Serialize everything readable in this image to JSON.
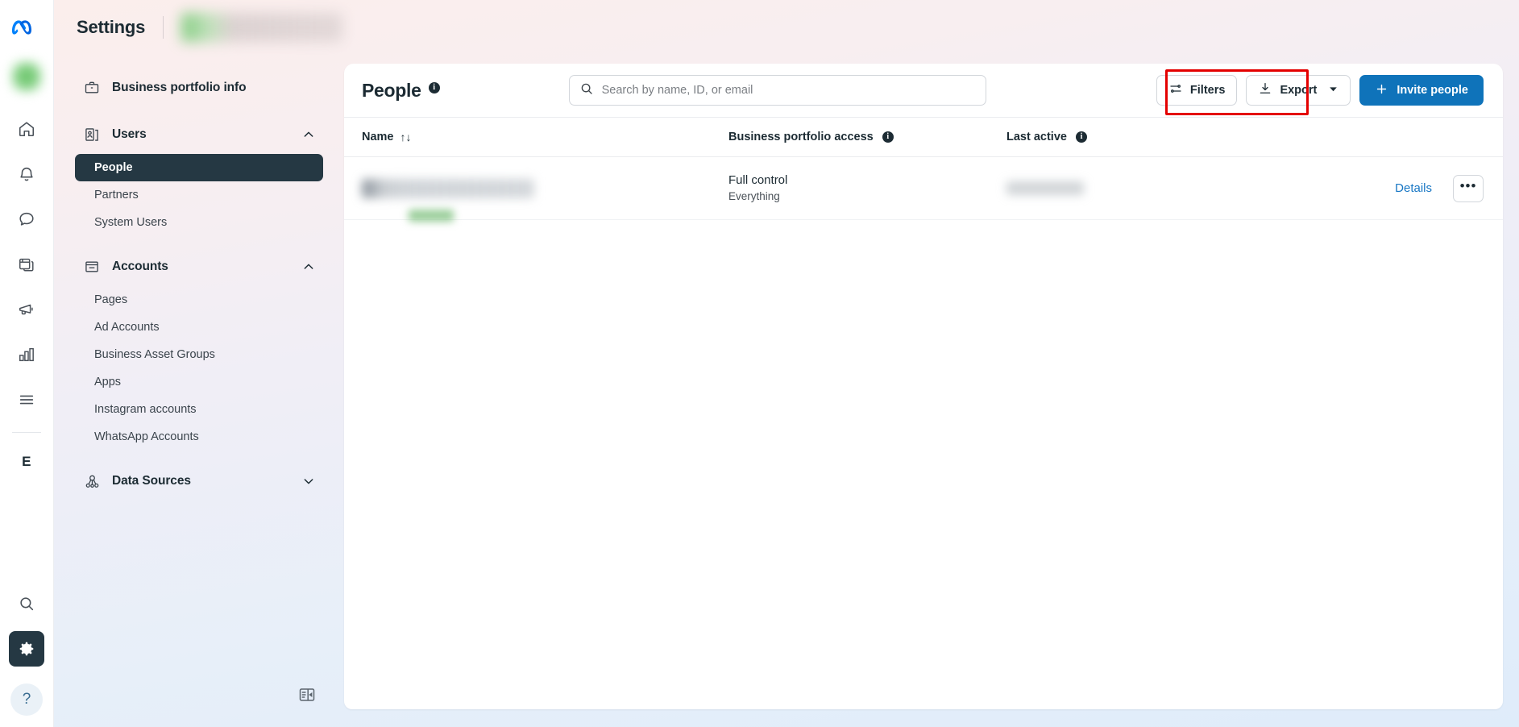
{
  "rail": {
    "logo": "meta-logo",
    "avatar": "user-avatar-blurred",
    "items": [
      {
        "icon": "home-icon",
        "name": "home"
      },
      {
        "icon": "bell-icon",
        "name": "notifications"
      },
      {
        "icon": "chat-bubble-icon",
        "name": "messages"
      },
      {
        "icon": "pages-icon",
        "name": "pages"
      },
      {
        "icon": "megaphone-icon",
        "name": "ads"
      },
      {
        "icon": "bar-chart-icon",
        "name": "insights"
      },
      {
        "icon": "menu-icon",
        "name": "all-tools"
      }
    ],
    "letter_badge": "E",
    "bottom": [
      {
        "icon": "search-icon",
        "name": "search",
        "active": false
      },
      {
        "icon": "gear-icon",
        "name": "settings",
        "active": true
      }
    ],
    "help_label": "?"
  },
  "header": {
    "title": "Settings",
    "business_name_redacted": ""
  },
  "nav": {
    "portfolio_info": {
      "label": "Business portfolio info",
      "icon": "briefcase-icon"
    },
    "groups": [
      {
        "label": "Users",
        "icon": "users-icon",
        "expanded": true,
        "chevron": "chevron-up-icon",
        "items": [
          {
            "label": "People",
            "active": true
          },
          {
            "label": "Partners",
            "active": false
          },
          {
            "label": "System Users",
            "active": false
          }
        ]
      },
      {
        "label": "Accounts",
        "icon": "accounts-icon",
        "expanded": true,
        "chevron": "chevron-up-icon",
        "items": [
          {
            "label": "Pages",
            "active": false
          },
          {
            "label": "Ad Accounts",
            "active": false
          },
          {
            "label": "Business Asset Groups",
            "active": false
          },
          {
            "label": "Apps",
            "active": false
          },
          {
            "label": "Instagram accounts",
            "active": false
          },
          {
            "label": "WhatsApp Accounts",
            "active": false
          }
        ]
      },
      {
        "label": "Data Sources",
        "icon": "data-sources-icon",
        "expanded": false,
        "chevron": "chevron-down-icon",
        "items": []
      }
    ]
  },
  "main": {
    "page_title": "People",
    "search": {
      "placeholder": "Search by name, ID, or email",
      "value": ""
    },
    "buttons": {
      "filters": "Filters",
      "export": "Export",
      "invite": "Invite people"
    },
    "table": {
      "columns": {
        "name": "Name",
        "access": "Business portfolio access",
        "last_active": "Last active"
      },
      "sort_glyph": "↑↓",
      "rows": [
        {
          "name_redacted": "",
          "access": "Full control",
          "access_detail": "Everything",
          "last_active_redacted": "",
          "details_label": "Details",
          "more_label": "•••"
        }
      ]
    }
  },
  "colors": {
    "primary_blue": "#0f73ba",
    "link_blue": "#1877c4",
    "active_dark": "#253843",
    "annotation_red": "#e40000"
  }
}
